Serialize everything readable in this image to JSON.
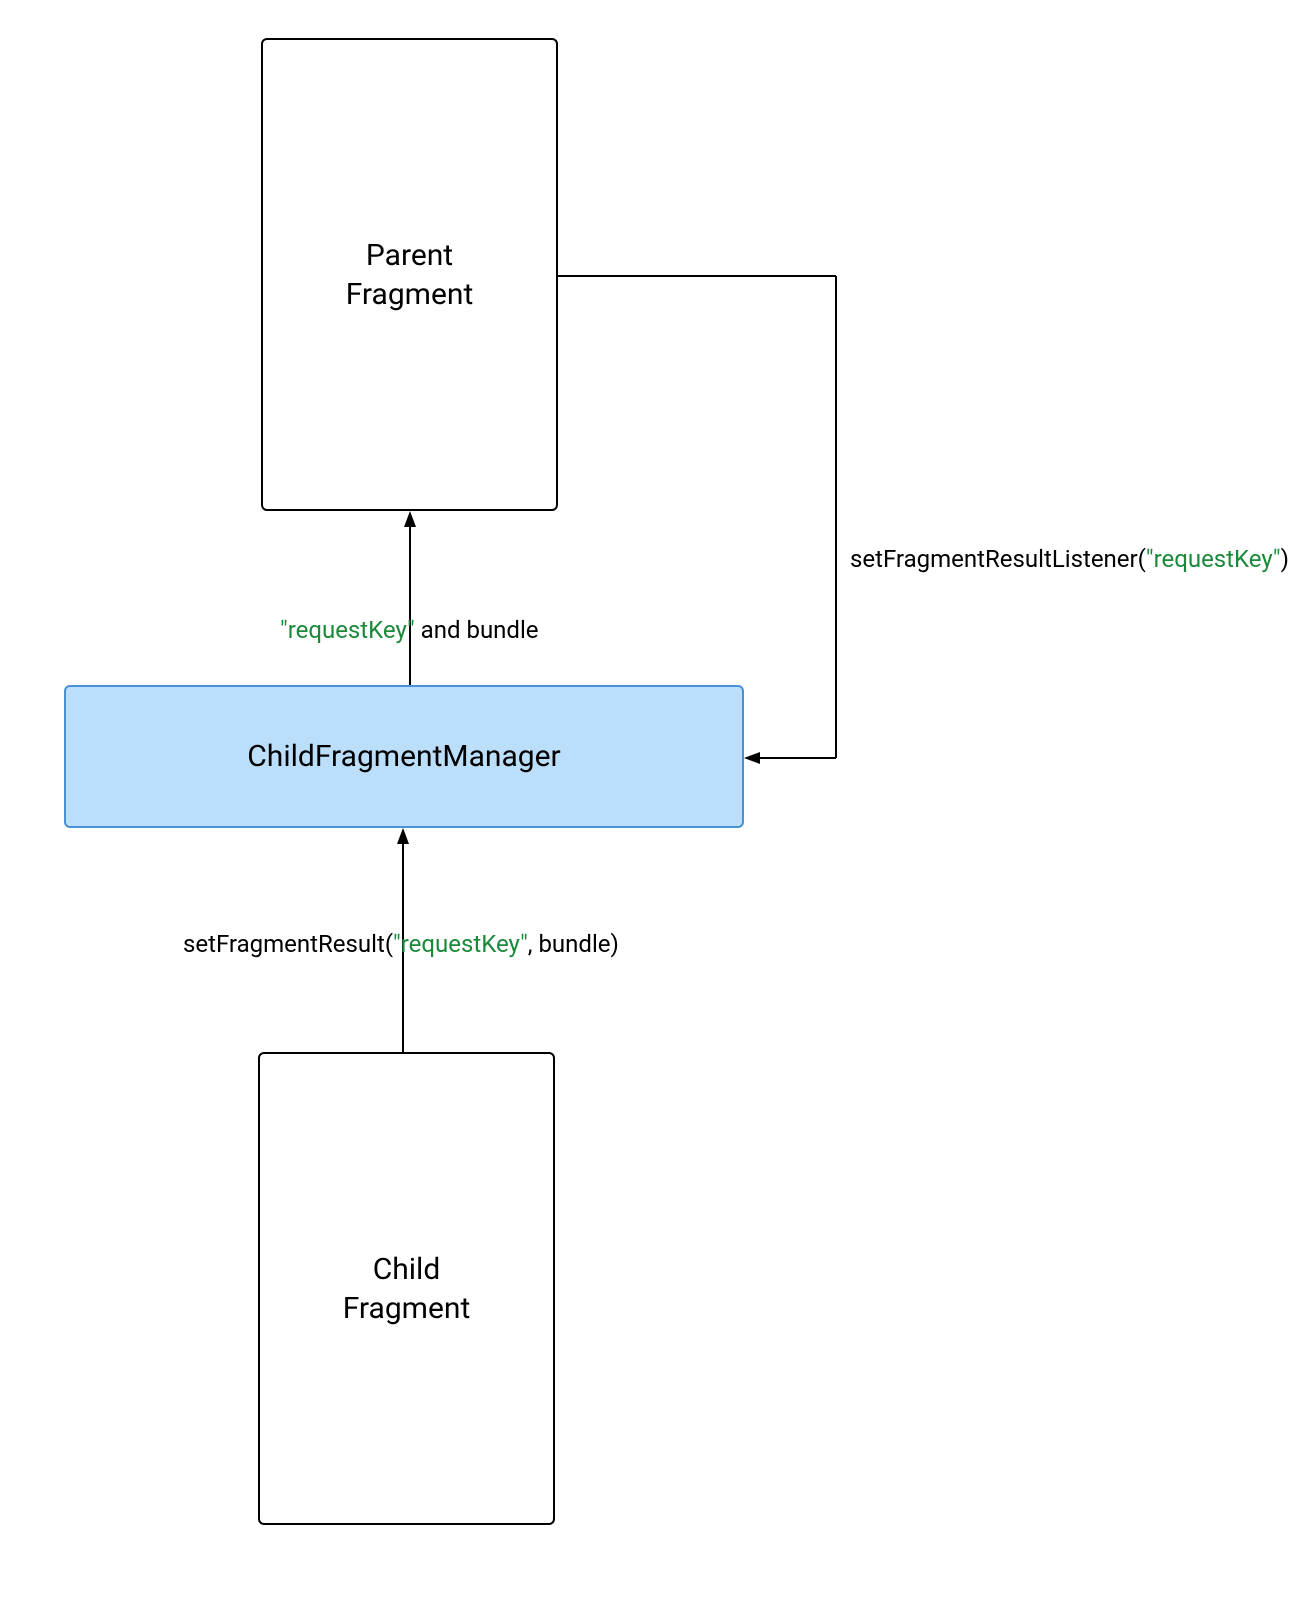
{
  "nodes": {
    "parent": {
      "label": "Parent\nFragment"
    },
    "manager": {
      "label": "ChildFragmentManager"
    },
    "child": {
      "label": "Child\nFragment"
    }
  },
  "edges": {
    "managerToParent": {
      "pre_key": "\"requestKey\"",
      "post": " and bundle"
    },
    "parentToManager": {
      "pre": "setFragmentResultListener(",
      "key": "\"requestKey\"",
      "post": ")"
    },
    "childToManager": {
      "pre": "setFragmentResult(",
      "key": "\"requestKey\"",
      "post": ", bundle)"
    }
  },
  "colors": {
    "managerFill": "#bbdefb",
    "managerStroke": "#4a90d6",
    "key": "#1a8a3a"
  }
}
